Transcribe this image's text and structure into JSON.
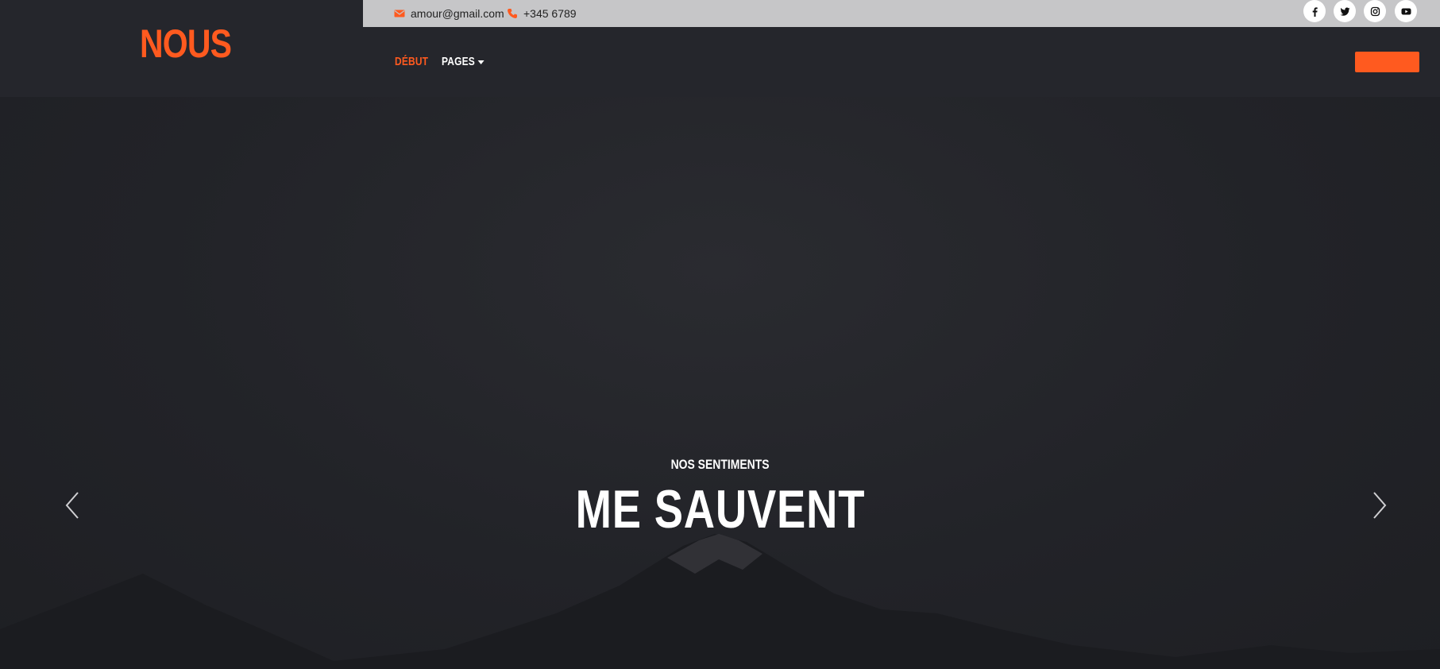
{
  "brand": {
    "logo": "NOUS",
    "accent_color": "#ff5a1f"
  },
  "topbar": {
    "email": {
      "icon": "envelope-icon",
      "text": "amour@gmail.com"
    },
    "phone": {
      "icon": "phone-icon",
      "text": "+345 6789"
    },
    "social": [
      {
        "name": "facebook-icon"
      },
      {
        "name": "twitter-icon"
      },
      {
        "name": "instagram-icon"
      },
      {
        "name": "youtube-icon"
      }
    ]
  },
  "nav": {
    "items": [
      {
        "label": "DÉBUT",
        "active": true
      },
      {
        "label": "PAGES",
        "has_dropdown": true
      }
    ],
    "cta_label": ""
  },
  "hero": {
    "subtitle": "NOS SENTIMENTS",
    "title": "ME SAUVENT",
    "prev_icon": "chevron-left-icon",
    "next_icon": "chevron-right-icon"
  }
}
